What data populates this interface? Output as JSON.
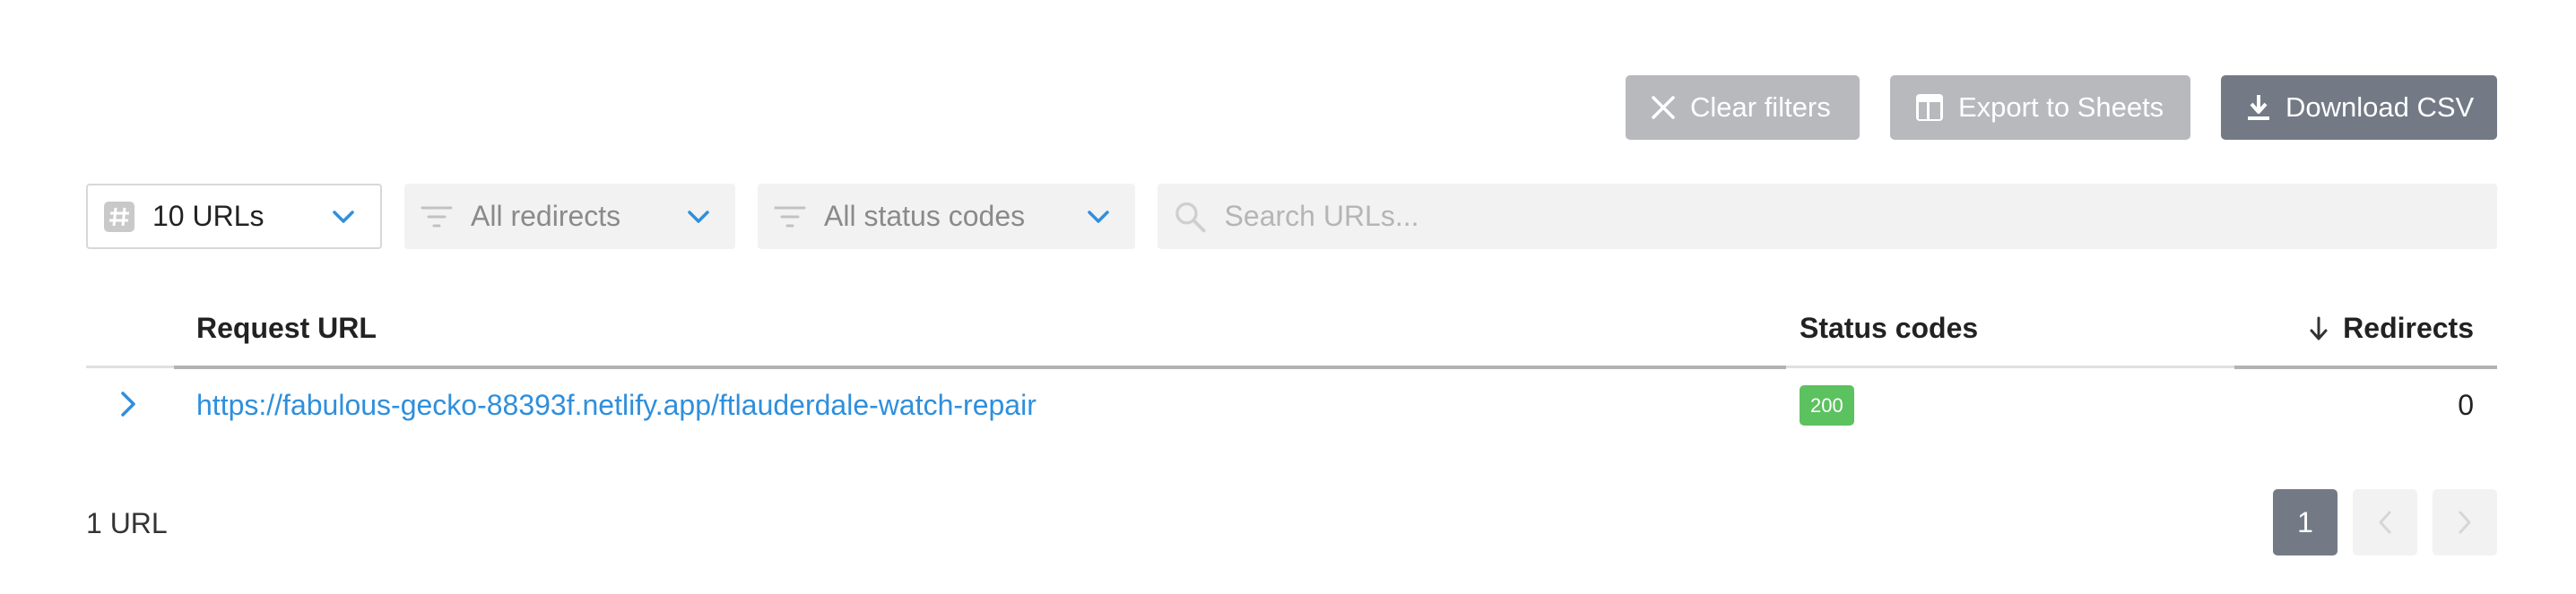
{
  "toolbar": {
    "clear_label": "Clear filters",
    "export_label": "Export to Sheets",
    "download_label": "Download CSV"
  },
  "filters": {
    "url_count": "10 URLs",
    "redirects": "All redirects",
    "status_codes": "All status codes",
    "search_placeholder": "Search URLs..."
  },
  "table": {
    "columns": {
      "url": "Request URL",
      "status": "Status codes",
      "redirects": "Redirects"
    },
    "rows": [
      {
        "url": "https://fabulous-gecko-88393f.netlify.app/ftlauderdale-watch-repair",
        "status": "200",
        "redirects": "0"
      }
    ]
  },
  "footer": {
    "count": "1 URL",
    "current_page": "1"
  },
  "colors": {
    "link": "#2f8fdc",
    "badge_success": "#5cc15f",
    "primary_button": "#737a86",
    "disabled_button": "#b7b9bd"
  }
}
